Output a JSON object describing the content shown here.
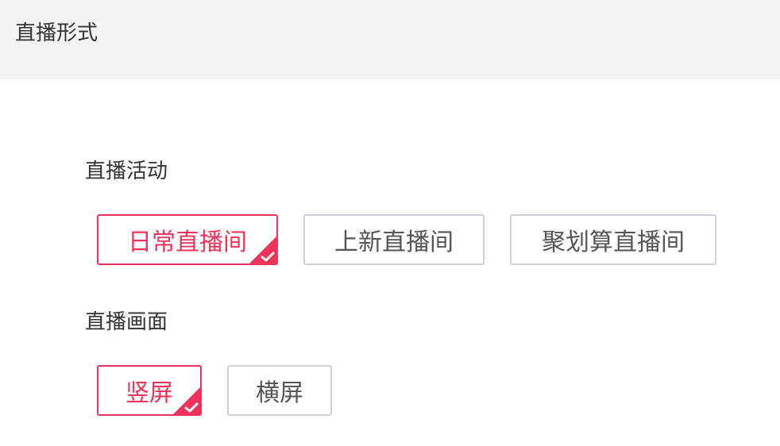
{
  "header": {
    "title": "直播形式"
  },
  "live_activity": {
    "label": "直播活动",
    "options": [
      {
        "label": "日常直播间",
        "selected": true
      },
      {
        "label": "上新直播间",
        "selected": false
      },
      {
        "label": "聚划算直播间",
        "selected": false
      }
    ]
  },
  "live_screen": {
    "label": "直播画面",
    "options": [
      {
        "label": "竖屏",
        "selected": true
      },
      {
        "label": "横屏",
        "selected": false
      }
    ]
  },
  "colors": {
    "accent": "#f0335a",
    "header_bg": "#f4f4f4",
    "border": "#cfcfd6",
    "text": "#333333"
  },
  "icons": {
    "selected_marker": "check-icon"
  }
}
